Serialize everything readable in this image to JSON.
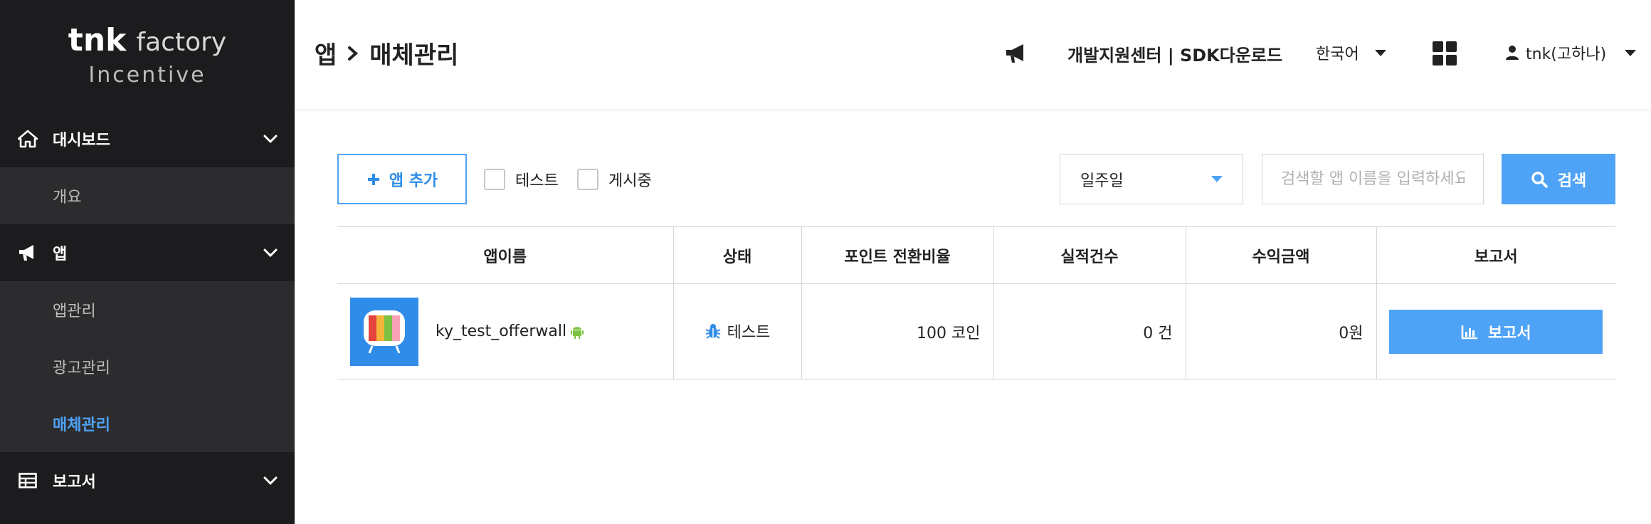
{
  "logo": {
    "main_bold": "tnk",
    "main_rest": "factory",
    "sub": "Incentive"
  },
  "sidebar": {
    "sections": [
      {
        "label": "대시보드",
        "icon": "home-icon",
        "items": [
          {
            "label": "개요"
          }
        ]
      },
      {
        "label": "앱",
        "icon": "megaphone-icon",
        "items": [
          {
            "label": "앱관리"
          },
          {
            "label": "광고관리"
          },
          {
            "label": "매체관리",
            "active": true
          }
        ]
      },
      {
        "label": "보고서",
        "icon": "table-icon",
        "items": []
      }
    ]
  },
  "header": {
    "breadcrumb": [
      "앱",
      "매체관리"
    ],
    "links": "개발지원센터 | SDK다운로드",
    "language": "한국어",
    "user": "tnk(고하나)"
  },
  "toolbar": {
    "add_label": "앱 추가",
    "checkbox_test": "테스트",
    "checkbox_live": "게시중",
    "period": "일주일",
    "search_placeholder": "검색할 앱 이름을 입력하세요",
    "search_label": "검색"
  },
  "table": {
    "columns": [
      "앱이름",
      "상태",
      "포인트 전환비율",
      "실적건수",
      "수익금액",
      "보고서"
    ],
    "rows": [
      {
        "app_name": "ky_test_offerwall",
        "platform": "android-icon",
        "status": "테스트",
        "point_ratio": "100 코인",
        "count": "0 건",
        "revenue": "0원",
        "report": "보고서"
      }
    ]
  },
  "colors": {
    "accent": "#4ea3f6",
    "sidebar_bg": "#1c1c1e",
    "sidebar_sub_bg": "#2c2c2e",
    "android": "#7cc142"
  }
}
